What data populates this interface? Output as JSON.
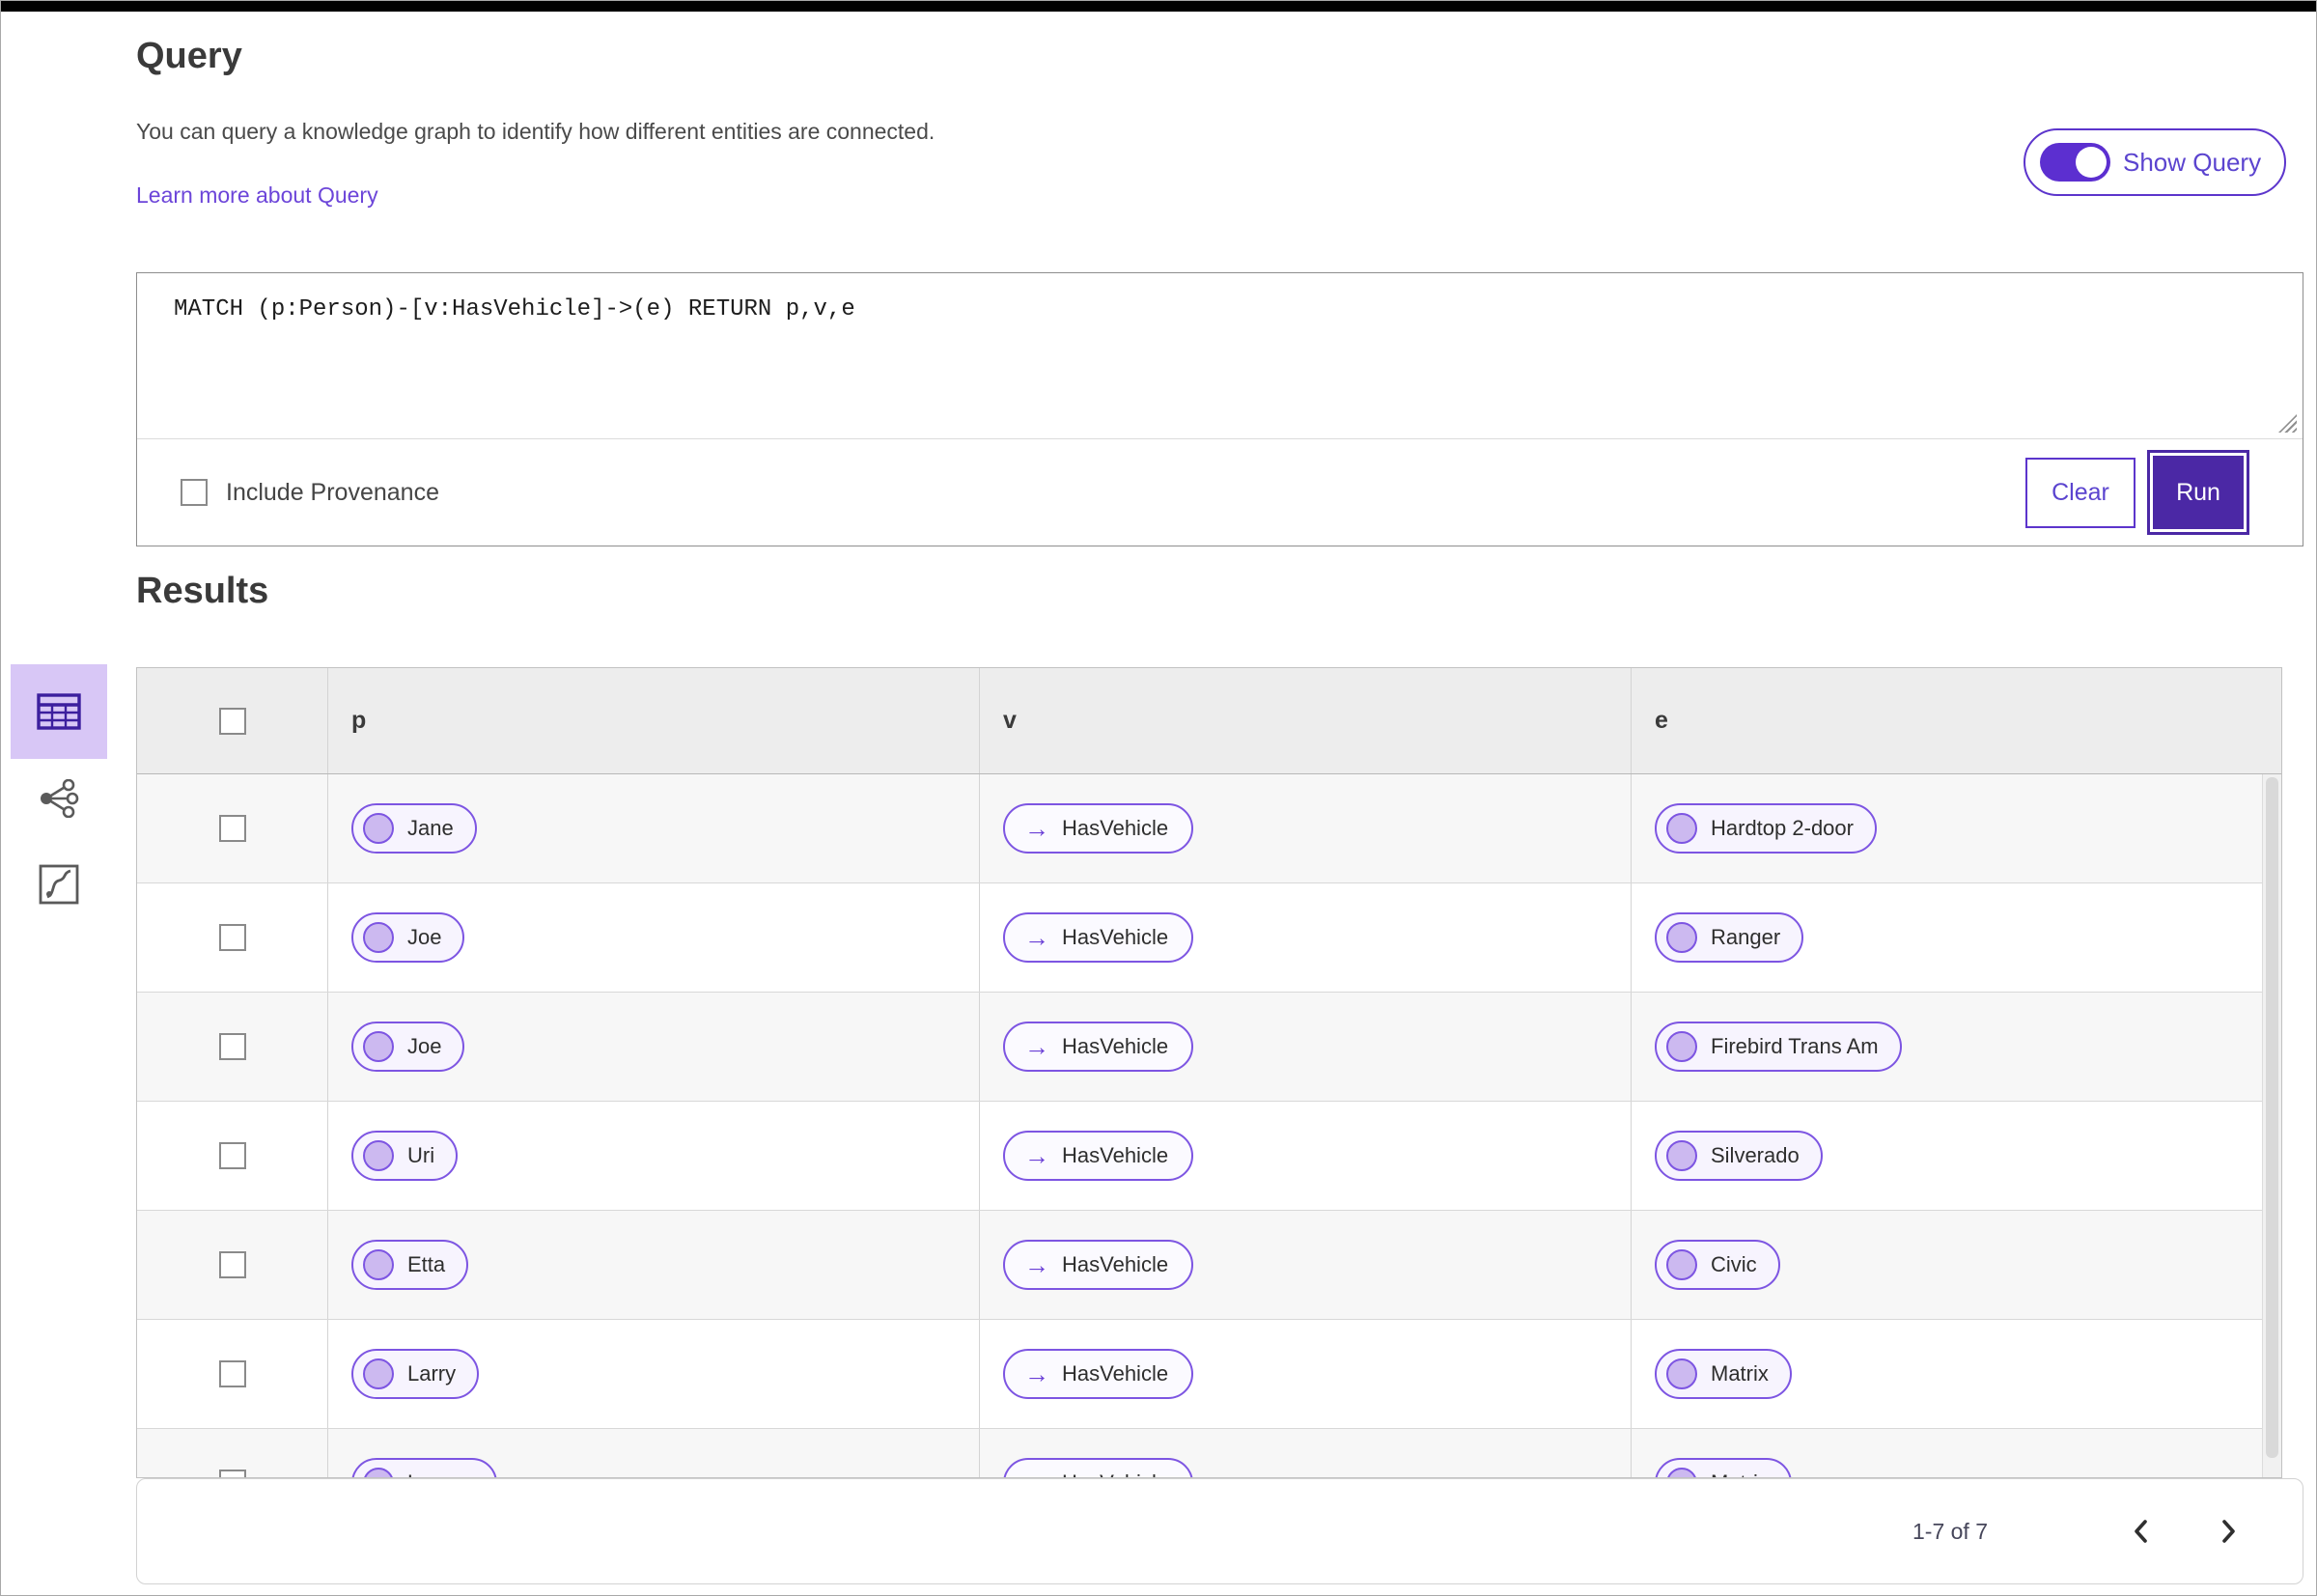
{
  "colors": {
    "accent_deep_purple": "#4b28a5",
    "accent_purple": "#5c35cc",
    "pill_border_purple": "#7d55e2",
    "pill_fill": "#f7f4fe",
    "link_purple": "#6c45d9",
    "selected_tile_bg": "#d8c7f6",
    "header_bg": "#ededed",
    "row_alt_bg": "#f7f7f7"
  },
  "query": {
    "title": "Query",
    "description": "You can query a knowledge graph to identify how different entities are connected.",
    "learn_more": "Learn more about Query",
    "show_query": {
      "label": "Show Query",
      "state": "on"
    },
    "editor_text": "MATCH (p:Person)-[v:HasVehicle]->(e) RETURN p,v,e",
    "include_provenance": {
      "label": "Include Provenance",
      "checked": false
    },
    "buttons": {
      "clear": "Clear",
      "run": "Run"
    }
  },
  "results": {
    "title": "Results",
    "view_switcher": [
      {
        "name": "table-view",
        "selected": true
      },
      {
        "name": "graph-view",
        "selected": false
      },
      {
        "name": "chart-view",
        "selected": false
      }
    ],
    "table": {
      "columns": [
        "p",
        "v",
        "e"
      ],
      "edge_arrow": "→",
      "rows": [
        {
          "p": "Jane",
          "v": "HasVehicle",
          "e": "Hardtop 2-door"
        },
        {
          "p": "Joe",
          "v": "HasVehicle",
          "e": "Ranger"
        },
        {
          "p": "Joe",
          "v": "HasVehicle",
          "e": "Firebird Trans Am"
        },
        {
          "p": "Uri",
          "v": "HasVehicle",
          "e": "Silverado"
        },
        {
          "p": "Etta",
          "v": "HasVehicle",
          "e": "Civic"
        },
        {
          "p": "Larry",
          "v": "HasVehicle",
          "e": "Matrix"
        },
        {
          "p": "Lauren",
          "v": "HasVehicle",
          "e": "Matrix"
        }
      ]
    },
    "pagination": {
      "range_label": "1-7 of 7"
    }
  }
}
